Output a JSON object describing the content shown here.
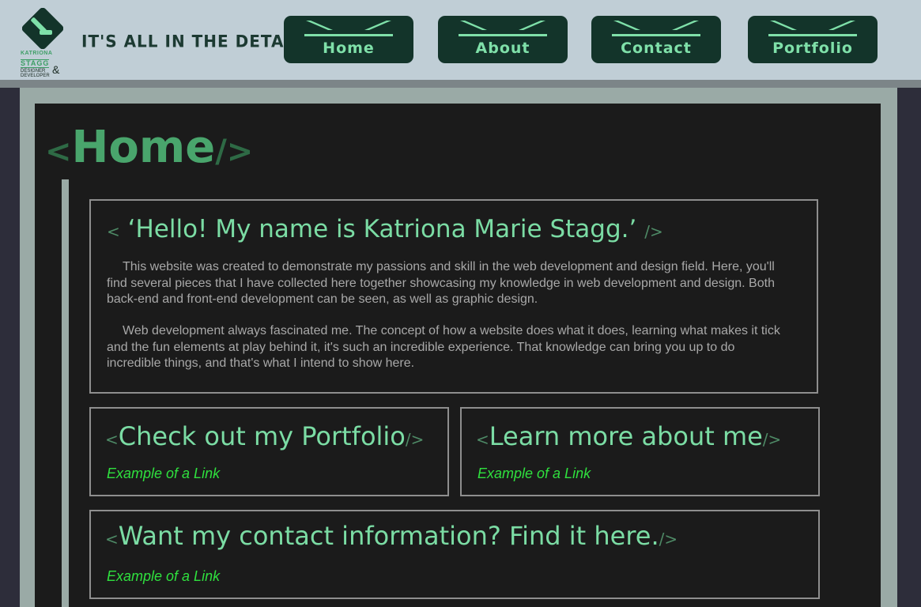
{
  "header": {
    "logo": {
      "line1": "KATRIONA",
      "line2": "STAGG",
      "line3": "DESIGNER",
      "line4": "DEVELOPER",
      "amp": "&"
    },
    "tagline": "IT'S ALL IN THE DETAILS",
    "nav": [
      "Home",
      "About",
      "Contact",
      "Portfolio"
    ]
  },
  "page": {
    "title_open": "<",
    "title": "Home",
    "title_close": "/>"
  },
  "intro": {
    "open": "<",
    "heading": "‘Hello! My name is Katriona Marie Stagg.’",
    "close": "/>",
    "p1": "This website was created to demonstrate my passions and skill in the web development and design field. Here, you'll find several pieces that I have collected here together showcasing my knowledge in web development and design. Both back-end and front-end development can be seen, as well as graphic design.",
    "p2": "Web development always fascinated me. The concept of how a website does what it does, learning what makes it tick and the fun elements at play behind it, it's such an incredible experience. That knowledge can bring you up to do incredible things, and that's what I intend to show here."
  },
  "cards": [
    {
      "open": "<",
      "heading": "Check out my Portfolio",
      "close": "/>",
      "link": "Example of a Link"
    },
    {
      "open": "<",
      "heading": "Learn more about me",
      "close": "/>",
      "link": "Example of a Link"
    },
    {
      "open": "<",
      "heading": "Want my contact information? Find it here.",
      "close": "/>",
      "link": "Example of a Link"
    }
  ],
  "colors": {
    "accent": "#7bdca4",
    "link": "#2fe03e",
    "nav_bg": "#13342a",
    "header_bg": "#c0ced6",
    "panel_bg": "#1b1b1b"
  }
}
